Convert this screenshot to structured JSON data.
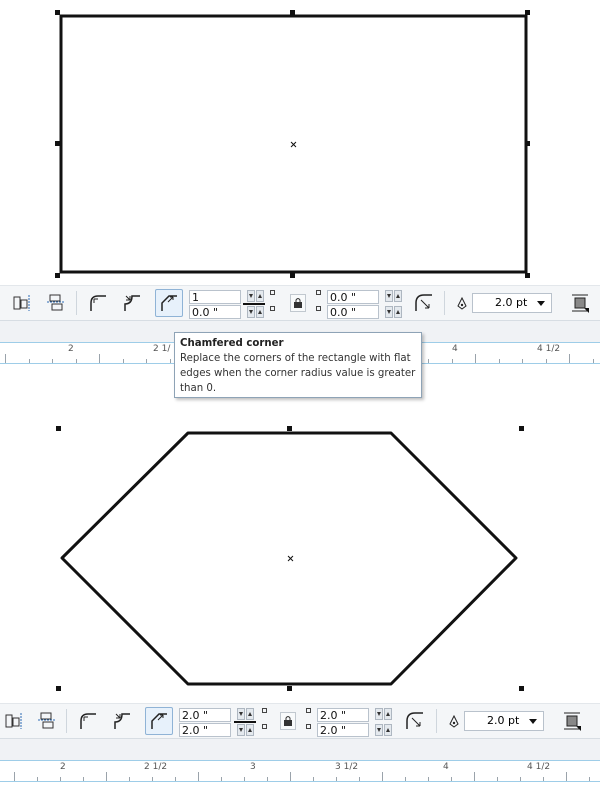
{
  "app": {
    "accent_color": "#8fb3d6",
    "tool_active_bg": "#e7f1fb"
  },
  "top_bar": {
    "corner_radius_value": "1",
    "corner_radius_bottom": "0.0 \"",
    "offset_top": "0.0 \"",
    "offset_bottom": "0.0 \"",
    "outline_width": "2.0 pt",
    "active_tool": "chamfered-corner"
  },
  "bottom_bar": {
    "corner_radius_value": "2.0 \"",
    "corner_radius_bottom": "2.0 \"",
    "offset_top": "2.0 \"",
    "offset_bottom": "2.0 \"",
    "outline_width": "2.0 pt",
    "active_tool": "chamfered-corner"
  },
  "top_ruler": {
    "labels": [
      "2",
      "2 1/",
      "4",
      "4 1/2"
    ]
  },
  "bottom_ruler": {
    "labels": [
      "2",
      "2 1/2",
      "3",
      "3 1/2",
      "4",
      "4 1/2"
    ]
  },
  "tooltip": {
    "title": "Chamfered corner",
    "body": "Replace the corners of the rectangle with flat edges when the corner radius value is greater than 0."
  },
  "icons": {
    "toolbar": [
      "align-left-icon",
      "align-distribute-icon",
      "round-corner-icon",
      "scalloped-corner-icon",
      "chamfered-corner-icon",
      "lock-icon",
      "scale-corners-icon",
      "pen-outline-icon",
      "wrap-icon"
    ]
  }
}
